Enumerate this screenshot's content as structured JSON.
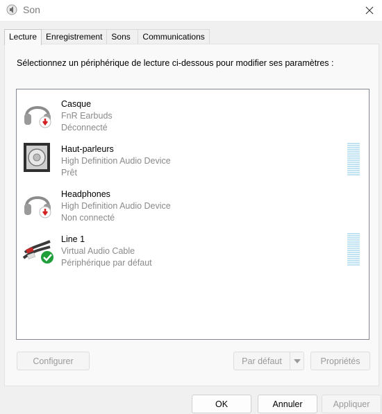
{
  "window": {
    "title": "Son",
    "icon": "speaker-icon",
    "close_icon": "close-icon"
  },
  "tabs": [
    {
      "label": "Lecture",
      "active": true
    },
    {
      "label": "Enregistrement",
      "active": false
    },
    {
      "label": "Sons",
      "active": false
    },
    {
      "label": "Communications",
      "active": false
    }
  ],
  "playback": {
    "instruction": "Sélectionnez un périphérique de lecture ci-dessous pour modifier ses paramètres :",
    "devices": [
      {
        "name": "Casque",
        "description": "FnR Earbuds",
        "status": "Déconnecté",
        "icon": "headphones-disconnected-icon",
        "meter": false
      },
      {
        "name": "Haut-parleurs",
        "description": "High Definition Audio Device",
        "status": "Prêt",
        "icon": "speaker-device-icon",
        "meter": true
      },
      {
        "name": "Headphones",
        "description": "High Definition Audio Device",
        "status": "Non connecté",
        "icon": "headphones-unplugged-icon",
        "meter": false
      },
      {
        "name": "Line 1",
        "description": "Virtual Audio Cable",
        "status": "Périphérique par défaut",
        "icon": "line-cable-default-icon",
        "meter": true
      }
    ],
    "buttons": {
      "configure": "Configurer",
      "set_default": "Par défaut",
      "properties": "Propriétés"
    }
  },
  "footer": {
    "ok": "OK",
    "cancel": "Annuler",
    "apply": "Appliquer"
  },
  "colors": {
    "meter": "#bfe3f2",
    "default_check": "#1f9e3a",
    "disconnect_badge": "#d42020"
  }
}
